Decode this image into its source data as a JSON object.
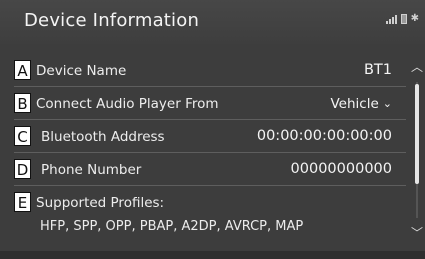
{
  "header": {
    "title": "Device Information"
  },
  "rows": [
    {
      "letter": "A",
      "label": "Device Name",
      "value": "BT1"
    },
    {
      "letter": "B",
      "label": "Connect Audio Player From",
      "value": "Vehicle"
    },
    {
      "letter": "C",
      "label": "Bluetooth Address",
      "value": "00:00:00:00:00:00"
    },
    {
      "letter": "D",
      "label": "Phone Number",
      "value": "00000000000"
    },
    {
      "letter": "E",
      "label": "Supported Profiles:",
      "value": "HFP, SPP, OPP, PBAP, A2DP, AVRCP, MAP"
    }
  ],
  "icons": {
    "status": [
      "signal-icon",
      "battery-icon",
      "bluetooth-icon"
    ],
    "dropdown": "chevron-down-icon",
    "scroll_up": "chevron-up-icon",
    "scroll_down": "chevron-down-icon"
  },
  "colors": {
    "background": "#3d3d3d",
    "text": "#f2f2f2",
    "divider": "#5e5e5e"
  }
}
